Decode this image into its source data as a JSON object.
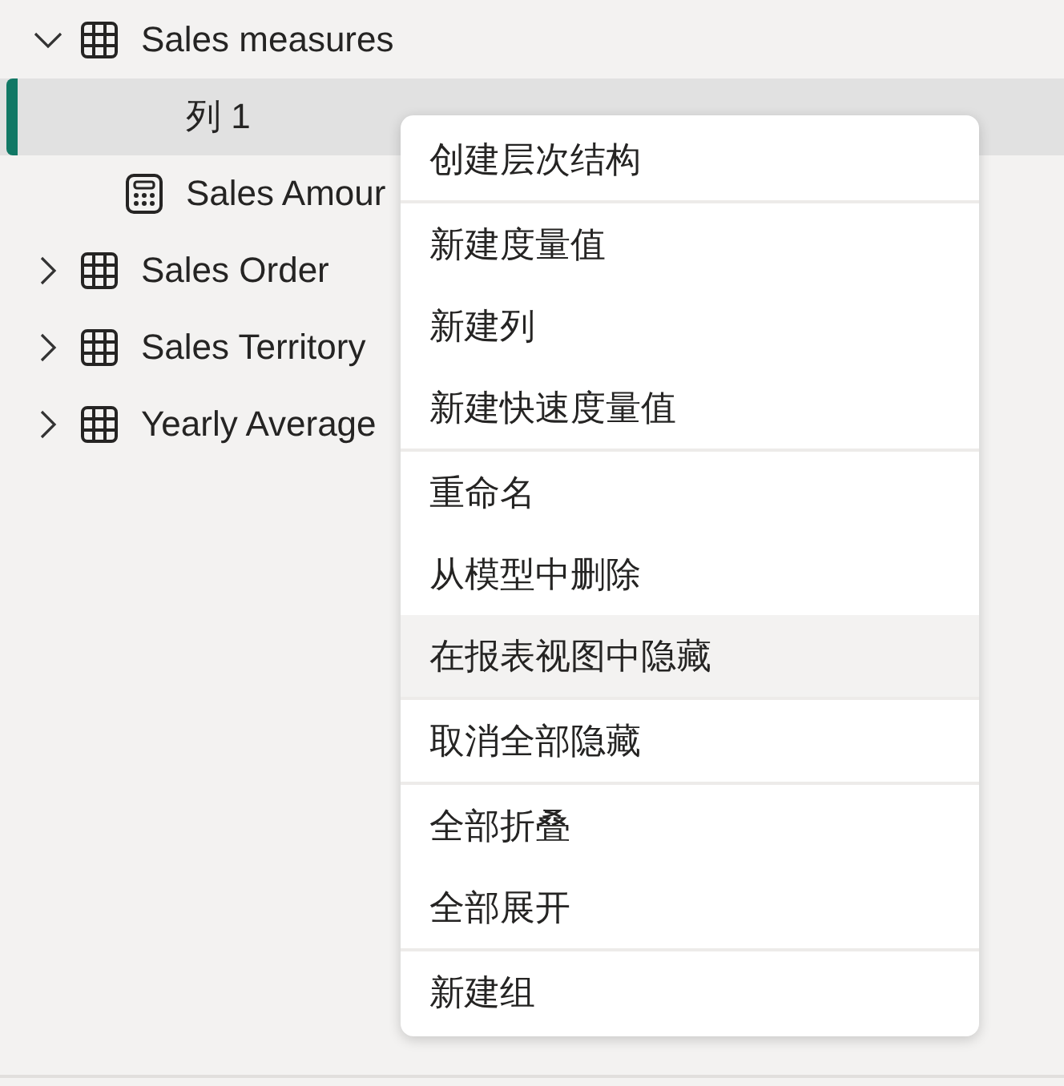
{
  "tree": [
    {
      "kind": "table",
      "label": "Sales measures",
      "expanded": true,
      "selected": false,
      "children": [
        {
          "kind": "column",
          "label": "列 1",
          "selected": true
        },
        {
          "kind": "measure",
          "label": "Sales Amour",
          "selected": false
        }
      ]
    },
    {
      "kind": "table",
      "label": "Sales Order",
      "expanded": false,
      "selected": false
    },
    {
      "kind": "table",
      "label": "Sales Territory",
      "expanded": false,
      "selected": false
    },
    {
      "kind": "table",
      "label": "Yearly Average",
      "expanded": false,
      "selected": false
    }
  ],
  "context_menu": {
    "groups": [
      [
        {
          "label": "创建层次结构",
          "highlighted": false
        }
      ],
      [
        {
          "label": "新建度量值",
          "highlighted": false
        },
        {
          "label": "新建列",
          "highlighted": false
        },
        {
          "label": "新建快速度量值",
          "highlighted": false
        }
      ],
      [
        {
          "label": "重命名",
          "highlighted": false
        },
        {
          "label": "从模型中删除",
          "highlighted": false
        },
        {
          "label": "在报表视图中隐藏",
          "highlighted": true
        }
      ],
      [
        {
          "label": "取消全部隐藏",
          "highlighted": false
        }
      ],
      [
        {
          "label": "全部折叠",
          "highlighted": false
        },
        {
          "label": "全部展开",
          "highlighted": false
        }
      ],
      [
        {
          "label": "新建组",
          "highlighted": false
        }
      ]
    ]
  }
}
